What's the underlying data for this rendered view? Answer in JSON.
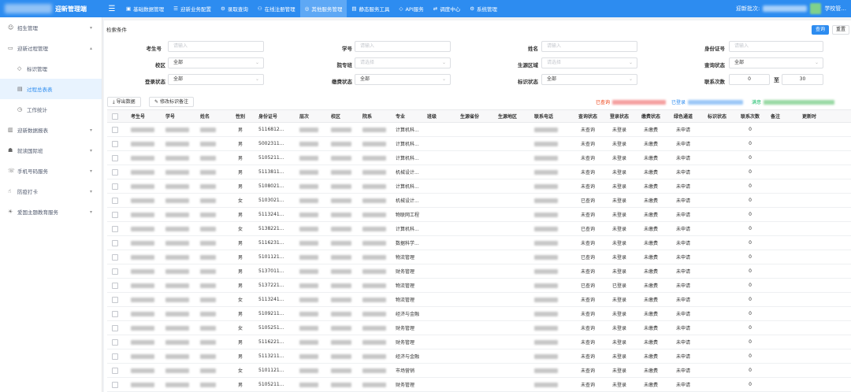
{
  "app": {
    "title": "迎新管理端"
  },
  "topnav": [
    {
      "icon": "▣",
      "label": "基础数据管理"
    },
    {
      "icon": "☰",
      "label": "迎新业务配置"
    },
    {
      "icon": "⚙",
      "label": "录取查询"
    },
    {
      "icon": "⚇",
      "label": "在线注册管理"
    },
    {
      "icon": "◎",
      "label": "其他服务管理",
      "active": true
    },
    {
      "icon": "▤",
      "label": "静态服务工具"
    },
    {
      "icon": "◇",
      "label": "API服务"
    },
    {
      "icon": "⇄",
      "label": "调度中心"
    },
    {
      "icon": "⚙",
      "label": "系统管理"
    }
  ],
  "top_right": {
    "batch_label": "迎新批次:",
    "user": "学校管..."
  },
  "sidebar": [
    {
      "icon": "☺",
      "label": "招生管理",
      "arrow": "▾"
    },
    {
      "icon": "▭",
      "label": "迎新过程管理",
      "arrow": "▴"
    },
    {
      "icon": "◇",
      "label": "标识管理",
      "sub": true
    },
    {
      "icon": "▤",
      "label": "过程总表表",
      "sub": true,
      "selected": true
    },
    {
      "icon": "◷",
      "label": "工作统计",
      "sub": true
    },
    {
      "icon": "▥",
      "label": "迎新数据报表",
      "arrow": "▾"
    },
    {
      "icon": "☗",
      "label": "就读国际班",
      "arrow": "▾"
    },
    {
      "icon": "☏",
      "label": "手机号码服务",
      "arrow": "▾"
    },
    {
      "icon": "☝",
      "label": "防疫打卡",
      "arrow": "▾"
    },
    {
      "icon": "☀",
      "label": "爱国主题教育服务",
      "arrow": "▾"
    }
  ],
  "search": {
    "title": "检索条件",
    "query_button": "查询",
    "reset_button": "重置",
    "fields": {
      "ksh": {
        "label": "考生号",
        "placeholder": "请输入"
      },
      "xh": {
        "label": "学号",
        "placeholder": "请输入"
      },
      "xm": {
        "label": "姓名",
        "placeholder": "请输入"
      },
      "sfzh": {
        "label": "身份证号",
        "placeholder": "请输入"
      },
      "xq": {
        "label": "校区",
        "value": "全部"
      },
      "yx": {
        "label": "院专班",
        "placeholder": "请选择"
      },
      "sydq": {
        "label": "生源区域",
        "placeholder": "请选择"
      },
      "cxzt": {
        "label": "查询状态",
        "value": "全部"
      },
      "dlzt": {
        "label": "登录状态",
        "value": "全部"
      },
      "jfzt": {
        "label": "缴费状态",
        "value": "全部"
      },
      "bszt": {
        "label": "标识状态",
        "value": "全部"
      },
      "lxcs": {
        "label": "联系次数",
        "from": "0",
        "sep": "至",
        "to": "30"
      }
    }
  },
  "toolbar": {
    "export_label": "导出数据",
    "edit_label": "修改标识备注",
    "legend": [
      {
        "label": "已查询",
        "color": "#f5a0a0"
      },
      {
        "label": "已登录",
        "color": "#9cc8f7"
      },
      {
        "label": "满意",
        "color": "#9ad9a5"
      }
    ]
  },
  "table": {
    "columns": [
      "",
      "考生号",
      "学号",
      "姓名",
      "性别",
      "身份证号",
      "层次",
      "校区",
      "院系",
      "专业",
      "班级",
      "生源省份",
      "生源地区",
      "联系电话",
      "查询状态",
      "登录状态",
      "缴费状态",
      "绿色通道",
      "标识状态",
      "联系次数",
      "备注",
      "更新时"
    ],
    "rows": [
      {
        "gender": "男",
        "id": "5116812...",
        "major": "计算机科...",
        "q": "未查询",
        "l": "未登录",
        "p": "未缴费",
        "g": "未申请",
        "n": "0"
      },
      {
        "gender": "男",
        "id": "5002311...",
        "major": "计算机科...",
        "q": "未查询",
        "l": "未登录",
        "p": "未缴费",
        "g": "未申请",
        "n": "0"
      },
      {
        "gender": "男",
        "id": "5105211...",
        "major": "计算机科...",
        "q": "未查询",
        "l": "未登录",
        "p": "未缴费",
        "g": "未申请",
        "n": "0"
      },
      {
        "gender": "男",
        "id": "5113811...",
        "major": "机械设计...",
        "q": "未查询",
        "l": "未登录",
        "p": "未缴费",
        "g": "未申请",
        "n": "0"
      },
      {
        "gender": "男",
        "id": "5108021...",
        "major": "计算机科...",
        "q": "未查询",
        "l": "未登录",
        "p": "未缴费",
        "g": "未申请",
        "n": "0"
      },
      {
        "gender": "女",
        "id": "5103021...",
        "major": "机械设计...",
        "q": "已查询",
        "l": "未登录",
        "p": "未缴费",
        "g": "未申请",
        "n": "0"
      },
      {
        "gender": "男",
        "id": "5113241...",
        "major": "物联网工程",
        "q": "未查询",
        "l": "未登录",
        "p": "未缴费",
        "g": "未申请",
        "n": "0"
      },
      {
        "gender": "女",
        "id": "5138221...",
        "major": "计算机科...",
        "q": "已查询",
        "l": "未登录",
        "p": "未缴费",
        "g": "未申请",
        "n": "0"
      },
      {
        "gender": "男",
        "id": "5116231...",
        "major": "数据科学...",
        "q": "未查询",
        "l": "未登录",
        "p": "未缴费",
        "g": "未申请",
        "n": "0"
      },
      {
        "gender": "男",
        "id": "5101121...",
        "major": "物流管理",
        "q": "已查询",
        "l": "未登录",
        "p": "未缴费",
        "g": "未申请",
        "n": "0"
      },
      {
        "gender": "男",
        "id": "5137011...",
        "major": "财务管理",
        "q": "未查询",
        "l": "未登录",
        "p": "未缴费",
        "g": "未申请",
        "n": "0"
      },
      {
        "gender": "男",
        "id": "5137221...",
        "major": "物流管理",
        "q": "已查询",
        "l": "已登录",
        "p": "未缴费",
        "g": "未申请",
        "n": "0"
      },
      {
        "gender": "女",
        "id": "5113241...",
        "major": "物流管理",
        "q": "未查询",
        "l": "未登录",
        "p": "未缴费",
        "g": "未申请",
        "n": "0"
      },
      {
        "gender": "男",
        "id": "5109211...",
        "major": "经济与金融",
        "q": "未查询",
        "l": "未登录",
        "p": "未缴费",
        "g": "未申请",
        "n": "0"
      },
      {
        "gender": "女",
        "id": "5105251...",
        "major": "财务管理",
        "q": "未查询",
        "l": "未登录",
        "p": "未缴费",
        "g": "未申请",
        "n": "0"
      },
      {
        "gender": "男",
        "id": "5116221...",
        "major": "财务管理",
        "q": "未查询",
        "l": "未登录",
        "p": "未缴费",
        "g": "未申请",
        "n": "0"
      },
      {
        "gender": "男",
        "id": "5113211...",
        "major": "经济与金融",
        "q": "未查询",
        "l": "未登录",
        "p": "未缴费",
        "g": "未申请",
        "n": "0"
      },
      {
        "gender": "女",
        "id": "5101121...",
        "major": "市场营销",
        "q": "未查询",
        "l": "未登录",
        "p": "未缴费",
        "g": "未申请",
        "n": "0"
      },
      {
        "gender": "男",
        "id": "5105211...",
        "major": "财务管理",
        "q": "未查询",
        "l": "未登录",
        "p": "未缴费",
        "g": "未申请",
        "n": "0"
      }
    ]
  }
}
